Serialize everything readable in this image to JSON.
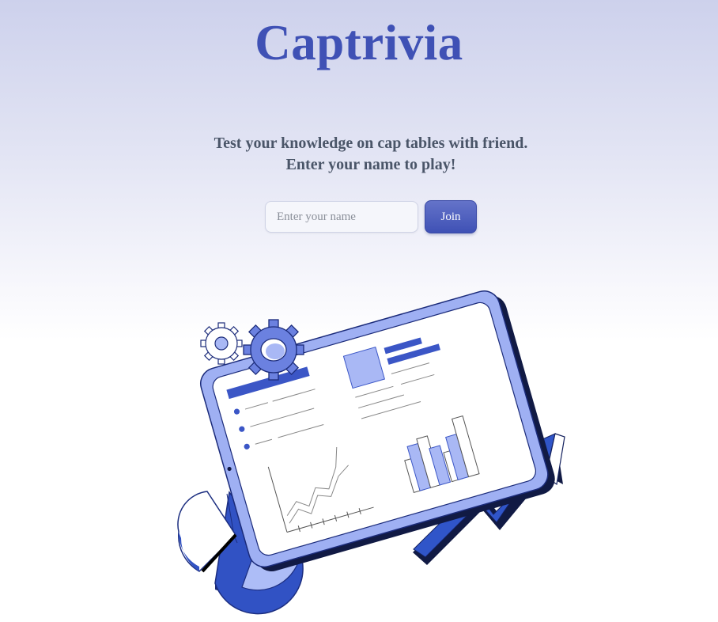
{
  "app": {
    "title": "Captrivia"
  },
  "intro": {
    "line1": "Test your knowledge on cap tables with friend.",
    "line2": "Enter your name to play!"
  },
  "join_form": {
    "name_placeholder": "Enter your name",
    "name_value": "",
    "join_label": "Join"
  },
  "colors": {
    "brand": "#3f51b5",
    "brand_light": "#a9b8f5",
    "text_muted": "#4a5568"
  },
  "illustration": {
    "icons": [
      "gear-icon",
      "tablet-dashboard",
      "pie-chart",
      "bar-chart",
      "line-chart",
      "growth-arrow"
    ]
  }
}
